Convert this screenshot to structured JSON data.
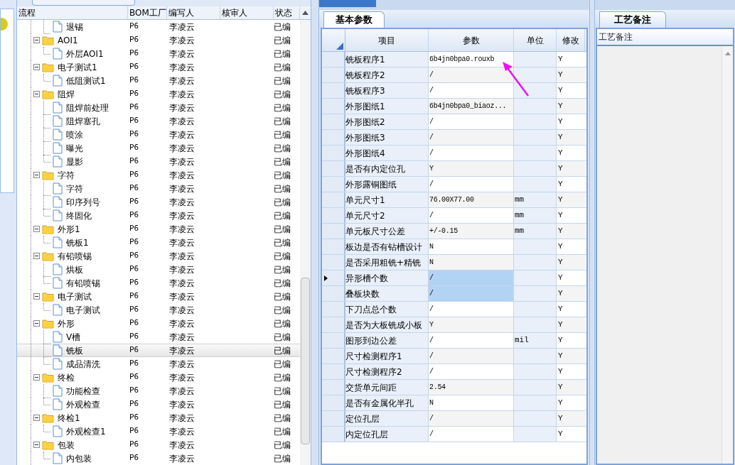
{
  "tree": {
    "columns": [
      "流程",
      "BOM工厂",
      "编写人",
      "核审人",
      "状态"
    ],
    "rows": [
      {
        "kind": "file",
        "name": "退锡",
        "factory": "P6",
        "author": "李凌云",
        "status": "已编",
        "selected": false
      },
      {
        "kind": "folder",
        "name": "AOI1",
        "factory": "P6",
        "author": "李凌云",
        "status": "已编",
        "selected": false,
        "expanded": true,
        "children": [
          {
            "kind": "file",
            "name": "外层AOI1",
            "factory": "P6",
            "author": "李凌云",
            "status": "已编",
            "selected": false
          }
        ]
      },
      {
        "kind": "folder",
        "name": "电子测试1",
        "factory": "P6",
        "author": "李凌云",
        "status": "已编",
        "selected": false,
        "expanded": true,
        "children": [
          {
            "kind": "file",
            "name": "低阻测试1",
            "factory": "P6",
            "author": "李凌云",
            "status": "已编",
            "selected": false
          }
        ]
      },
      {
        "kind": "folder",
        "name": "阻焊",
        "factory": "P6",
        "author": "李凌云",
        "status": "已编",
        "selected": false,
        "expanded": true,
        "children": [
          {
            "kind": "file",
            "name": "阻焊前处理",
            "factory": "P6",
            "author": "李凌云",
            "status": "已编",
            "selected": false
          },
          {
            "kind": "file",
            "name": "阻焊塞孔",
            "factory": "P6",
            "author": "李凌云",
            "status": "已编",
            "selected": false
          },
          {
            "kind": "file",
            "name": "喷涂",
            "factory": "P6",
            "author": "李凌云",
            "status": "已编",
            "selected": false
          },
          {
            "kind": "file",
            "name": "曝光",
            "factory": "P6",
            "author": "李凌云",
            "status": "已编",
            "selected": false
          },
          {
            "kind": "file",
            "name": "显影",
            "factory": "P6",
            "author": "李凌云",
            "status": "已编",
            "selected": false
          }
        ]
      },
      {
        "kind": "folder",
        "name": "字符",
        "factory": "P6",
        "author": "李凌云",
        "status": "已编",
        "selected": false,
        "expanded": true,
        "children": [
          {
            "kind": "file",
            "name": "字符",
            "factory": "P6",
            "author": "李凌云",
            "status": "已编",
            "selected": false
          },
          {
            "kind": "file",
            "name": "印序列号",
            "factory": "P6",
            "author": "李凌云",
            "status": "已编",
            "selected": false
          },
          {
            "kind": "file",
            "name": "终固化",
            "factory": "P6",
            "author": "李凌云",
            "status": "已编",
            "selected": false
          }
        ]
      },
      {
        "kind": "folder",
        "name": "外形1",
        "factory": "P6",
        "author": "李凌云",
        "status": "已编",
        "selected": false,
        "expanded": true,
        "children": [
          {
            "kind": "file",
            "name": "铣板1",
            "factory": "P6",
            "author": "李凌云",
            "status": "已编",
            "selected": false
          }
        ]
      },
      {
        "kind": "folder",
        "name": "有铅喷锡",
        "factory": "P6",
        "author": "李凌云",
        "status": "已编",
        "selected": false,
        "expanded": true,
        "children": [
          {
            "kind": "file",
            "name": "烘板",
            "factory": "P6",
            "author": "李凌云",
            "status": "已编",
            "selected": false
          },
          {
            "kind": "file",
            "name": "有铅喷锡",
            "factory": "P6",
            "author": "李凌云",
            "status": "已编",
            "selected": false
          }
        ]
      },
      {
        "kind": "folder",
        "name": "电子测试",
        "factory": "P6",
        "author": "李凌云",
        "status": "已编",
        "selected": false,
        "expanded": true,
        "children": [
          {
            "kind": "file",
            "name": "电子测试",
            "factory": "P6",
            "author": "李凌云",
            "status": "已编",
            "selected": false
          }
        ]
      },
      {
        "kind": "folder",
        "name": "外形",
        "factory": "P6",
        "author": "李凌云",
        "status": "已编",
        "selected": false,
        "expanded": true,
        "children": [
          {
            "kind": "file",
            "name": "V槽",
            "factory": "P6",
            "author": "李凌云",
            "status": "已编",
            "selected": false
          },
          {
            "kind": "file",
            "name": "铣板",
            "factory": "P6",
            "author": "李凌云",
            "status": "已编",
            "selected": true
          },
          {
            "kind": "file",
            "name": "成品清洗",
            "factory": "P6",
            "author": "李凌云",
            "status": "已编",
            "selected": false
          }
        ]
      },
      {
        "kind": "folder",
        "name": "终检",
        "factory": "P6",
        "author": "李凌云",
        "status": "已编",
        "selected": false,
        "expanded": true,
        "children": [
          {
            "kind": "file",
            "name": "功能检查",
            "factory": "P6",
            "author": "李凌云",
            "status": "已编",
            "selected": false
          },
          {
            "kind": "file",
            "name": "外观检查",
            "factory": "P6",
            "author": "李凌云",
            "status": "已编",
            "selected": false
          }
        ]
      },
      {
        "kind": "folder",
        "name": "终检1",
        "factory": "P6",
        "author": "李凌云",
        "status": "已编",
        "selected": false,
        "expanded": true,
        "children": [
          {
            "kind": "file",
            "name": "外观检查1",
            "factory": "P6",
            "author": "李凌云",
            "status": "已编",
            "selected": false
          }
        ]
      },
      {
        "kind": "folder",
        "name": "包装",
        "factory": "P6",
        "author": "李凌云",
        "status": "已编",
        "selected": false,
        "expanded": true,
        "children": [
          {
            "kind": "file",
            "name": "内包装",
            "factory": "P6",
            "author": "李凌云",
            "status": "已编",
            "selected": false
          }
        ]
      }
    ]
  },
  "params": {
    "tab": "基本参数",
    "columns": [
      "项目",
      "参数",
      "单位",
      "修改"
    ],
    "rows": [
      {
        "item": "铣板程序1",
        "value": "6b4jn0bpa0.rouxb",
        "unit": "",
        "edit": "Y",
        "current": false,
        "selected": false
      },
      {
        "item": "铣板程序2",
        "value": "/",
        "unit": "",
        "edit": "Y",
        "current": false,
        "selected": false
      },
      {
        "item": "铣板程序3",
        "value": "/",
        "unit": "",
        "edit": "Y",
        "current": false,
        "selected": false
      },
      {
        "item": "外形图纸1",
        "value": "6b4jn0bpa0_biaoz...",
        "unit": "",
        "edit": "Y",
        "current": false,
        "selected": false
      },
      {
        "item": "外形图纸2",
        "value": "/",
        "unit": "",
        "edit": "Y",
        "current": false,
        "selected": false
      },
      {
        "item": "外形图纸3",
        "value": "/",
        "unit": "",
        "edit": "Y",
        "current": false,
        "selected": false
      },
      {
        "item": "外形图纸4",
        "value": "/",
        "unit": "",
        "edit": "Y",
        "current": false,
        "selected": false
      },
      {
        "item": "是否有内定位孔",
        "value": "Y",
        "unit": "",
        "edit": "Y",
        "current": false,
        "selected": false
      },
      {
        "item": "外形露铜图纸",
        "value": "/",
        "unit": "",
        "edit": "Y",
        "current": false,
        "selected": false
      },
      {
        "item": "单元尺寸1",
        "value": "76.00X77.00",
        "unit": "mm",
        "edit": "Y",
        "current": false,
        "selected": false
      },
      {
        "item": "单元尺寸2",
        "value": "/",
        "unit": "mm",
        "edit": "Y",
        "current": false,
        "selected": false
      },
      {
        "item": "单元板尺寸公差",
        "value": "+/-0.15",
        "unit": "mm",
        "edit": "Y",
        "current": false,
        "selected": false
      },
      {
        "item": "板边是否有钻槽设计",
        "value": "N",
        "unit": "",
        "edit": "Y",
        "current": false,
        "selected": false
      },
      {
        "item": "是否采用粗铣+精铣",
        "value": "N",
        "unit": "",
        "edit": "Y",
        "current": false,
        "selected": false
      },
      {
        "item": "异形槽个数",
        "value": "/",
        "unit": "",
        "edit": "Y",
        "current": true,
        "selected": true
      },
      {
        "item": "叠板块数",
        "value": "/",
        "unit": "",
        "edit": "Y",
        "current": false,
        "selected": true
      },
      {
        "item": "下刀点总个数",
        "value": "/",
        "unit": "",
        "edit": "Y",
        "current": false,
        "selected": false
      },
      {
        "item": "是否为大板铣成小板",
        "value": "Y",
        "unit": "",
        "edit": "Y",
        "current": false,
        "selected": false
      },
      {
        "item": "图形到边公差",
        "value": "/",
        "unit": "mil",
        "edit": "Y",
        "current": false,
        "selected": false
      },
      {
        "item": "尺寸检测程序1",
        "value": "/",
        "unit": "",
        "edit": "Y",
        "current": false,
        "selected": false
      },
      {
        "item": "尺寸检测程序2",
        "value": "/",
        "unit": "",
        "edit": "Y",
        "current": false,
        "selected": false
      },
      {
        "item": "交货单元间距",
        "value": "2.54",
        "unit": "",
        "edit": "Y",
        "current": false,
        "selected": false
      },
      {
        "item": "是否有金属化半孔",
        "value": "N",
        "unit": "",
        "edit": "Y",
        "current": false,
        "selected": false
      },
      {
        "item": "定位孔层",
        "value": "/",
        "unit": "",
        "edit": "Y",
        "current": false,
        "selected": false
      },
      {
        "item": "内定位孔层",
        "value": "/",
        "unit": "",
        "edit": "Y",
        "current": false,
        "selected": false
      }
    ]
  },
  "notes": {
    "tab": "工艺备注",
    "column": "工艺备注"
  }
}
